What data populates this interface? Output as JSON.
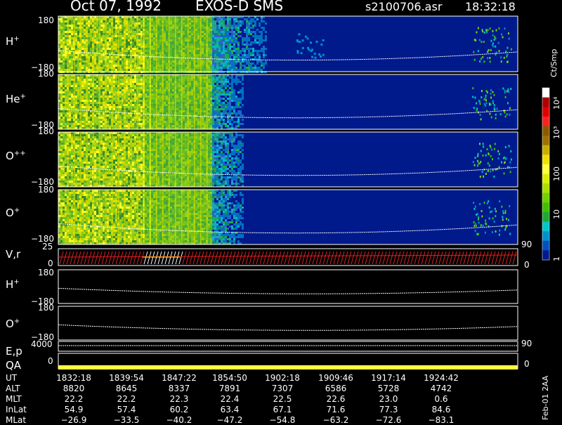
{
  "header": {
    "date": "Oct 07, 1992",
    "instrument": "EXOS-D SMS",
    "file": "s2100706.asr",
    "time": "18:32:18"
  },
  "panels": [
    {
      "label": "H",
      "sup": "+",
      "ytop": "180",
      "ybot": "−180"
    },
    {
      "label": "He",
      "sup": "+",
      "ytop": "180",
      "ybot": "−180"
    },
    {
      "label": "O",
      "sup": "++",
      "ytop": "180",
      "ybot": "−180"
    },
    {
      "label": "O",
      "sup": "+",
      "ytop": "180",
      "ybot": "−180",
      "right_tick": "90"
    }
  ],
  "vr_panel": {
    "label": "V,r",
    "ytop": "25",
    "ybot": "0",
    "right_tick": "0"
  },
  "lower_panels": [
    {
      "label": "H",
      "sup": "+",
      "ytop": "180",
      "ybot": "−180"
    },
    {
      "label": "O",
      "sup": "+",
      "ytop": "180",
      "ybot": "−180"
    }
  ],
  "ep_panel": {
    "label": "E,p",
    "ytop": "4000",
    "right_tick": "90"
  },
  "qa_panel": {
    "label": "QA",
    "ytop": "0",
    "right_tick": "0"
  },
  "colorbar": {
    "unit": "Ct/Smp",
    "labels": [
      "10⁴",
      "10³",
      "100",
      "10",
      "1"
    ],
    "colors": [
      "#ffffff",
      "#b00000",
      "#e00000",
      "#ff2020",
      "#8b5a00",
      "#a07000",
      "#c8b000",
      "#f0e000",
      "#ffff40",
      "#d8f000",
      "#a8e000",
      "#70d000",
      "#40c000",
      "#20a830",
      "#00c8c8",
      "#0090d0",
      "#0050c0",
      "#001a8c"
    ]
  },
  "footer": {
    "labels": [
      "UT",
      "ALT",
      "MLT",
      "InLat",
      "MLat"
    ],
    "columns": [
      [
        "1832:18",
        "8820",
        "22.2",
        "54.9",
        "−26.9"
      ],
      [
        "1839:54",
        "8645",
        "22.2",
        "57.4",
        "−33.5"
      ],
      [
        "1847:22",
        "8337",
        "22.3",
        "60.2",
        "−40.2"
      ],
      [
        "1854:50",
        "7891",
        "22.4",
        "63.4",
        "−47.2"
      ],
      [
        "1902:18",
        "7307",
        "22.5",
        "67.1",
        "−54.8"
      ],
      [
        "1909:46",
        "6586",
        "22.6",
        "71.6",
        "−63.2"
      ],
      [
        "1917:14",
        "5728",
        "23.0",
        "77.3",
        "−72.6"
      ],
      [
        "1924:42",
        "4742",
        "0.6",
        "84.6",
        "−83.1"
      ]
    ],
    "version": "Feb-01 2AA"
  },
  "chart_data": {
    "type": "heatmap",
    "title": "Oct 07, 1992   EXOS-D SMS",
    "x_ticks": [
      "1832:18",
      "1839:54",
      "1847:22",
      "1854:50",
      "1902:18",
      "1909:46",
      "1917:14",
      "1924:42"
    ],
    "series": [
      {
        "name": "H+",
        "ylim": [
          -180,
          180
        ],
        "active_until": "1856:00",
        "burst": "1923:00–1928:00"
      },
      {
        "name": "He+",
        "ylim": [
          -180,
          180
        ],
        "active_until": "1855:00",
        "burst": "1923:00–1928:00"
      },
      {
        "name": "O++",
        "ylim": [
          -180,
          180
        ],
        "active_until": "1855:00",
        "burst": "1923:00–1928:00"
      },
      {
        "name": "O+",
        "ylim": [
          -180,
          180
        ],
        "active_until": "1855:00",
        "burst": "1923:00–1928:00"
      }
    ],
    "colorbar_range": [
      1,
      10000
    ],
    "colorbar_scale": "log"
  }
}
